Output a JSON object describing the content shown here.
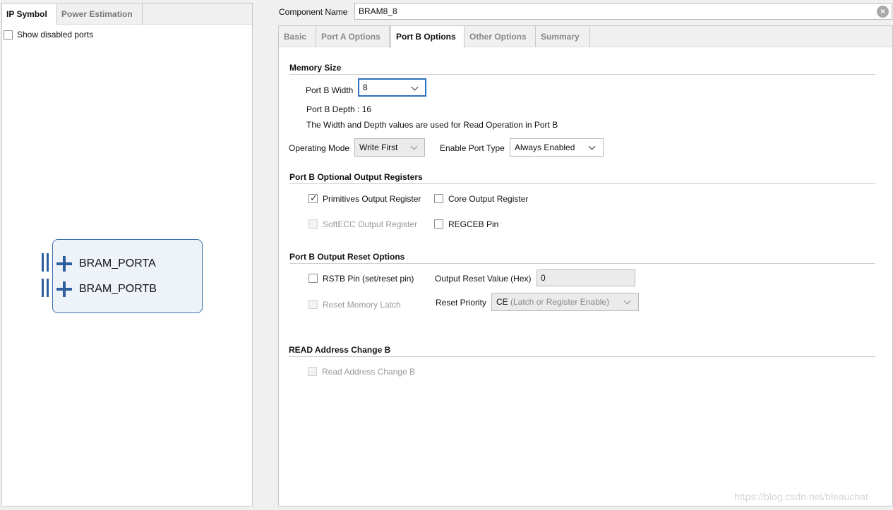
{
  "left_tabs": {
    "ip_symbol": "IP Symbol",
    "power_estimation": "Power Estimation"
  },
  "show_disabled_ports": {
    "label": "Show disabled ports",
    "checked": false
  },
  "ip_symbol": {
    "ports": [
      "BRAM_PORTA",
      "BRAM_PORTB"
    ]
  },
  "component": {
    "label": "Component Name",
    "value": "BRAM8_8"
  },
  "tabs": [
    "Basic",
    "Port A Options",
    "Port B Options",
    "Other Options",
    "Summary"
  ],
  "active_tab": "Port B Options",
  "memory_size": {
    "title": "Memory Size",
    "width_label": "Port B Width",
    "width_value": "8",
    "depth_text": "Port B Depth : 16",
    "note": "The Width and Depth values are used for Read Operation in Port B",
    "operating_mode_label": "Operating Mode",
    "operating_mode_value": "Write First",
    "enable_port_type_label": "Enable Port Type",
    "enable_port_type_value": "Always Enabled"
  },
  "output_registers": {
    "title": "Port B Optional Output Registers",
    "primitives": {
      "label": "Primitives Output Register",
      "checked": true
    },
    "core": {
      "label": "Core Output Register",
      "checked": false
    },
    "softecc": {
      "label": "SoftECC Output Register",
      "checked": false,
      "disabled": true
    },
    "regceb": {
      "label": "REGCEB Pin",
      "checked": false
    }
  },
  "reset_options": {
    "title": "Port B Output Reset Options",
    "rstb": {
      "label": "RSTB Pin (set/reset pin)",
      "checked": false
    },
    "reset_value_label": "Output Reset Value (Hex)",
    "reset_value": "0",
    "reset_memory_latch": {
      "label": "Reset Memory Latch",
      "checked": false,
      "disabled": true
    },
    "reset_priority_label": "Reset Priority",
    "reset_priority_value_main": "CE",
    "reset_priority_value_rest": " (Latch or Register Enable)"
  },
  "read_address": {
    "title": "READ Address Change B",
    "checkbox": {
      "label": "Read Address Change B",
      "checked": false,
      "disabled": true
    }
  },
  "watermark": "https://blog.csdn.net/bleauchat"
}
